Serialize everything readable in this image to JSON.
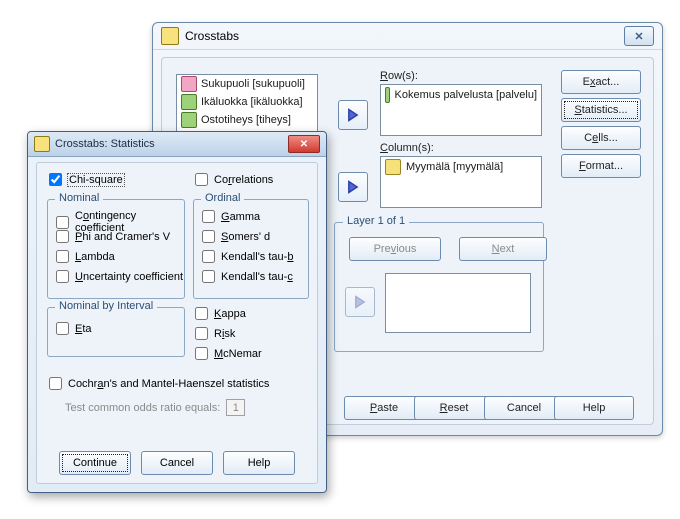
{
  "main": {
    "title": "Crosstabs",
    "close_glyph": "✕",
    "varlist": [
      {
        "icon": "nom",
        "label": "Sukupuoli [sukupuoli]"
      },
      {
        "icon": "ord",
        "label": "Ikäluokka [ikäluokka]"
      },
      {
        "icon": "ord",
        "label": "Ostotiheys [tiheys]"
      }
    ],
    "rows_label": "Row(s):",
    "rows_item": {
      "icon": "ord",
      "label": "Kokemus palvelusta [palvelu]"
    },
    "cols_label": "Column(s):",
    "cols_item": {
      "icon": "nom",
      "label": "Myymälä [myymälä]"
    },
    "layer_legend": "Layer 1 of 1",
    "prev": "Previous",
    "next": "Next",
    "side": {
      "exact": "Exact...",
      "statistics": "Statistics...",
      "cells": "Cells...",
      "format": "Format..."
    },
    "footer": {
      "paste": "Paste",
      "reset": "Reset",
      "cancel": "Cancel",
      "help": "Help"
    }
  },
  "stats": {
    "title": "Crosstabs: Statistics",
    "close_glyph": "✕",
    "chi": "Chi-square",
    "corr": "Correlations",
    "nominal_legend": "Nominal",
    "nom_items": {
      "cc": "Contingency coefficient",
      "phi": "Phi and Cramer's V",
      "lambda": "Lambda",
      "uc": "Uncertainty coefficient"
    },
    "ordinal_legend": "Ordinal",
    "ord_items": {
      "gamma": "Gamma",
      "somers": "Somers' d",
      "ktb": "Kendall's tau-b",
      "ktc": "Kendall's tau-c"
    },
    "nbi_legend": "Nominal by Interval",
    "eta": "Eta",
    "right": {
      "kappa": "Kappa",
      "risk": "Risk",
      "mcnemar": "McNemar"
    },
    "cmh": "Cochran's and Mantel-Haenszel statistics",
    "odds_label": "Test common odds ratio equals:",
    "odds_value": "1",
    "buttons": {
      "continue": "Continue",
      "cancel": "Cancel",
      "help": "Help"
    }
  }
}
